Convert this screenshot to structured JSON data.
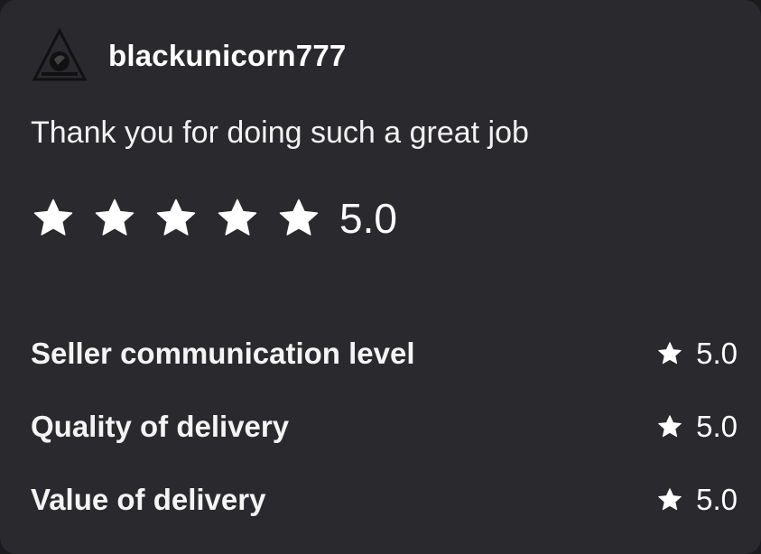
{
  "review": {
    "user": {
      "avatar_icon": "black-unicorn-logo-icon",
      "username": "blackunicorn777"
    },
    "text": "Thank you for doing such a great job",
    "overall": {
      "rating": 5,
      "max_rating": 5,
      "score_label": "5.0",
      "star_icon": "star-filled-icon"
    },
    "breakdown": [
      {
        "label": "Seller communication level",
        "score_label": "5.0",
        "icon": "star-filled-icon"
      },
      {
        "label": "Quality of delivery",
        "score_label": "5.0",
        "icon": "star-filled-icon"
      },
      {
        "label": "Value of delivery",
        "score_label": "5.0",
        "icon": "star-filled-icon"
      }
    ]
  },
  "colors": {
    "card_background": "#2a2a2e",
    "text": "#ffffff",
    "star": "#ffffff"
  }
}
